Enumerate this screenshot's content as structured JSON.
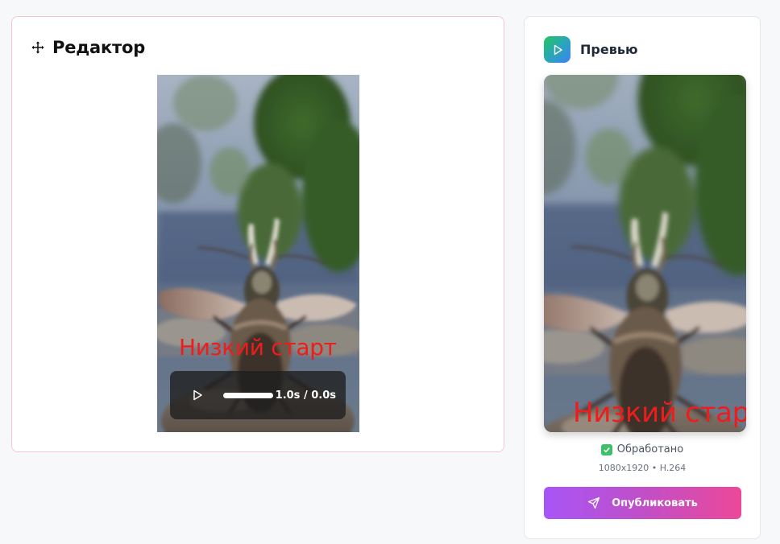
{
  "editor": {
    "title": "Редактор",
    "caption": "Низкий старт",
    "player": {
      "time": "1.0s / 0.0s",
      "progress": 1.0
    }
  },
  "preview": {
    "title": "Превью",
    "caption": "Низкий старт",
    "status": "Обработано",
    "meta": "1080x1920 • H.264",
    "publish_label": "Опубликовать"
  },
  "colors": {
    "caption": "#ef1c1c",
    "accent_gradient": [
      "#a855f7",
      "#ec4899"
    ],
    "preview_badge_gradient": [
      "#22c55e",
      "#3b82f6"
    ],
    "editor_border": "#f7c6d5",
    "status_check": "#3fbf6c"
  },
  "icons": {
    "editor": "move-icon",
    "preview": "play-icon",
    "status": "check-icon",
    "publish": "send-icon",
    "player": "play-icon"
  }
}
